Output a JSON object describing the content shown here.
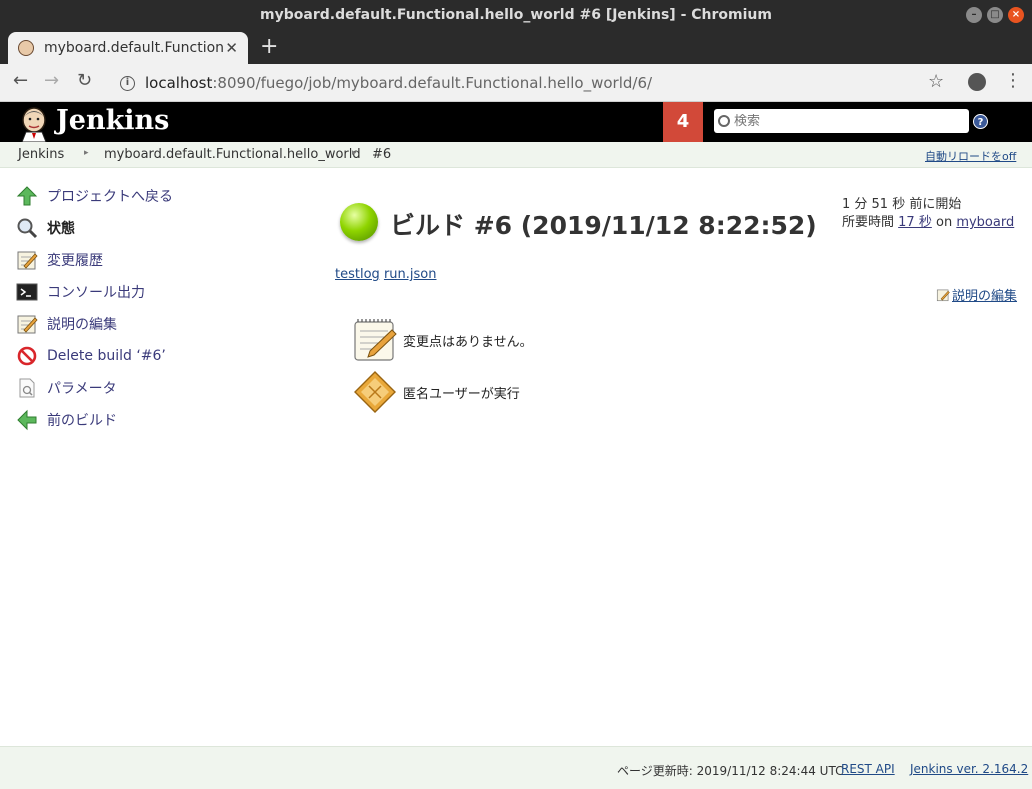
{
  "window": {
    "title": "myboard.default.Functional.hello_world #6 [Jenkins] - Chromium"
  },
  "tab": {
    "title": "myboard.default.Functional.hello_world #6 [Jenkins]",
    "close": "✕",
    "new_tab": "+"
  },
  "address": {
    "host": "localhost",
    "path": ":8090/fuego/job/myboard.default.Functional.hello_world/6/",
    "info": "i"
  },
  "jenkins": {
    "name": "Jenkins",
    "notification_count": "4",
    "search_placeholder": "検索",
    "help": "?"
  },
  "breadcrumb": {
    "items": [
      "Jenkins",
      "myboard.default.Functional.hello_world",
      "#6"
    ],
    "separator": "▸",
    "auto_refresh": "自動リロードをoff"
  },
  "sidebar": {
    "items": [
      {
        "label": "プロジェクトへ戻る",
        "icon": "up-arrow-icon"
      },
      {
        "label": "状態",
        "icon": "magnifier-icon"
      },
      {
        "label": "変更履歴",
        "icon": "notepad-icon"
      },
      {
        "label": "コンソール出力",
        "icon": "terminal-icon"
      },
      {
        "label": "説明の編集",
        "icon": "notepad-icon"
      },
      {
        "label": "Delete build ‘#6’",
        "icon": "no-entry-icon"
      },
      {
        "label": "パラメータ",
        "icon": "document-search-icon"
      },
      {
        "label": "前のビルド",
        "icon": "left-arrow-icon"
      }
    ]
  },
  "build": {
    "status_color": "#8fd400",
    "title": "ビルド #6 (2019/11/12 8:22:52)",
    "started": "1 分 51 秒 前に開始",
    "duration_label": "所要時間",
    "duration": "17 秒",
    "on": "on",
    "node": "myboard",
    "artifacts": [
      "testlog",
      "run.json"
    ],
    "edit_description": "説明の編集",
    "no_changes": "変更点はありません。",
    "started_by": "匿名ユーザーが実行"
  },
  "footer": {
    "updated": "ページ更新時: 2019/11/12 8:24:44 UTC",
    "rest_api": "REST API",
    "version": "Jenkins ver. 2.164.2"
  }
}
